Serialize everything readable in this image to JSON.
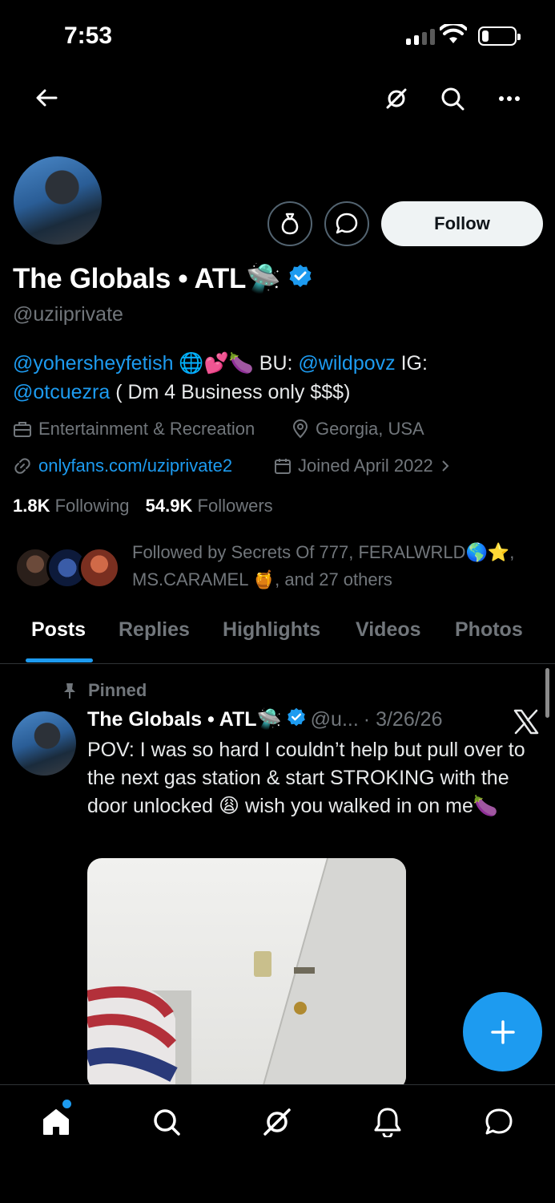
{
  "status_bar": {
    "time": "7:53"
  },
  "profile": {
    "display_name": "The Globals • ATL🛸",
    "handle": "@uziiprivate",
    "follow_label": "Follow",
    "bio": {
      "mention1": "@yohersheyfetish",
      "emojis1": " 🌐💕🍆 ",
      "bu_label": "BU: ",
      "mention2": "@wildpovz",
      "ig_label": " IG:",
      "mention3": "@otcuezra",
      "tail": " ( Dm 4 Business only $$$)"
    },
    "category": "Entertainment & Recreation",
    "location": "Georgia, USA",
    "website": "onlyfans.com/uziprivate2",
    "joined": "Joined April 2022",
    "following_count": "1.8K",
    "following_label": "Following",
    "followers_count": "54.9K",
    "followers_label": "Followers",
    "followed_by_line1": "Followed by Secrets Of 777, FERALWRLD🌎⭐,",
    "followed_by_line2": "MS.CARAMEL 🍯, and 27 others"
  },
  "tabs": [
    "Posts",
    "Replies",
    "Highlights",
    "Videos",
    "Photos"
  ],
  "pinned_post": {
    "pinned_label": "Pinned",
    "author_name": "The Globals • ATL🛸",
    "author_handle": "@u...",
    "date": "· 3/26/26",
    "text": "POV: I was so hard I couldn’t help but pull over to the next gas station & start STROKING with the door unlocked 😩 wish you walked in on me🍆"
  },
  "colors": {
    "accent": "#1d9bf0",
    "background": "#000000",
    "muted": "#71767b"
  }
}
